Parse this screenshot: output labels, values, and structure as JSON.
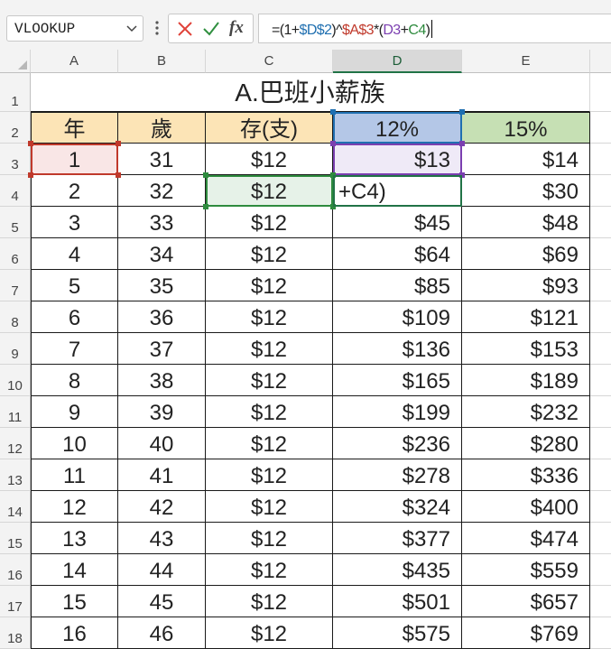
{
  "formula_bar": {
    "name_box": "VLOOKUP",
    "cancel_icon": "x-icon",
    "enter_icon": "check-icon",
    "fx_label": "fx",
    "formula_parts": [
      {
        "text": "=(1+",
        "color": "#222222"
      },
      {
        "text": "$D$2",
        "color": "#1f6fb0"
      },
      {
        "text": ")^",
        "color": "#222222"
      },
      {
        "text": "$A$3",
        "color": "#c0392b"
      },
      {
        "text": "*(",
        "color": "#222222"
      },
      {
        "text": "D3",
        "color": "#7b3fb0"
      },
      {
        "text": "+",
        "color": "#222222"
      },
      {
        "text": "C4",
        "color": "#2e8b3e"
      },
      {
        "text": ")",
        "color": "#222222"
      }
    ]
  },
  "columns": [
    "A",
    "B",
    "C",
    "D",
    "E"
  ],
  "rows": [
    "1",
    "2",
    "3",
    "4",
    "5",
    "6",
    "7",
    "8",
    "9",
    "10",
    "11",
    "12",
    "13",
    "14",
    "15",
    "16",
    "17",
    "18"
  ],
  "title": "A.巴班小薪族",
  "header_row": [
    "年",
    "歲",
    "存(支)",
    "12%",
    "15%"
  ],
  "data_rows": [
    [
      "1",
      "31",
      "$12",
      "$13",
      "$14"
    ],
    [
      "2",
      "32",
      "$12",
      "+C4)",
      "$30"
    ],
    [
      "3",
      "33",
      "$12",
      "$45",
      "$48"
    ],
    [
      "4",
      "34",
      "$12",
      "$64",
      "$69"
    ],
    [
      "5",
      "35",
      "$12",
      "$85",
      "$93"
    ],
    [
      "6",
      "36",
      "$12",
      "$109",
      "$121"
    ],
    [
      "7",
      "37",
      "$12",
      "$136",
      "$153"
    ],
    [
      "8",
      "38",
      "$12",
      "$165",
      "$189"
    ],
    [
      "9",
      "39",
      "$12",
      "$199",
      "$232"
    ],
    [
      "10",
      "40",
      "$12",
      "$236",
      "$280"
    ],
    [
      "11",
      "41",
      "$12",
      "$278",
      "$336"
    ],
    [
      "12",
      "42",
      "$12",
      "$324",
      "$400"
    ],
    [
      "13",
      "43",
      "$12",
      "$377",
      "$474"
    ],
    [
      "14",
      "44",
      "$12",
      "$435",
      "$559"
    ],
    [
      "15",
      "45",
      "$12",
      "$501",
      "$657"
    ],
    [
      "16",
      "46",
      "$12",
      "$575",
      "$769"
    ]
  ],
  "colors": {
    "header_yellow": "#fce4b6",
    "header_blue": "#b4c7e7",
    "header_green": "#c6e0b4",
    "ref_red": "#c0392b",
    "ref_blue": "#1f6fb0",
    "ref_purple": "#7b3fb0",
    "ref_green": "#2e8b3e",
    "selected_column": "#217346"
  }
}
